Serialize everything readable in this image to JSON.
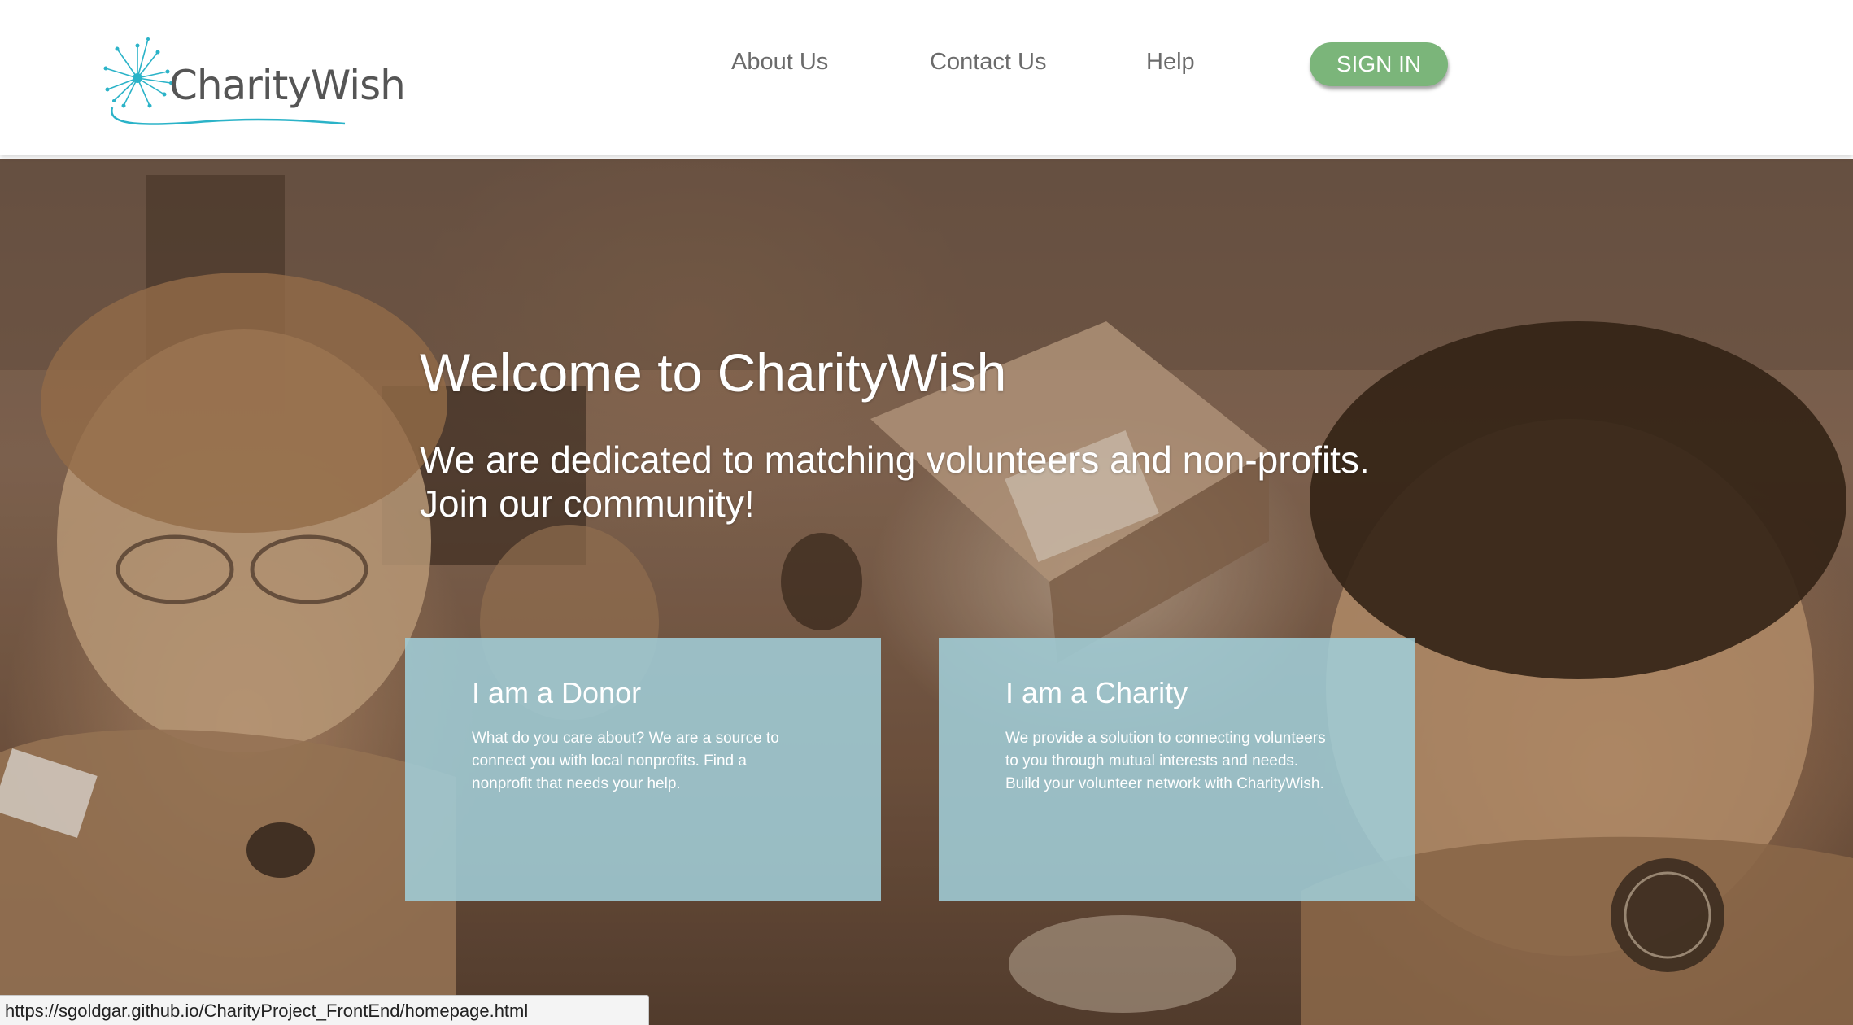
{
  "brand": {
    "name": "CharityWish",
    "logo_icon": "dandelion-logo-icon",
    "accent_color": "#2bb3c8"
  },
  "nav": {
    "about": "About Us",
    "contact": "Contact Us",
    "help": "Help",
    "signin": "SIGN IN",
    "signin_color": "#7bb57a"
  },
  "hero": {
    "title": "Welcome to CharityWish",
    "subtitle_line1": "We are dedicated to matching volunteers and non-profits.",
    "subtitle_line2": "Join our community!"
  },
  "cards": {
    "donor": {
      "title": "I am a Donor",
      "lines": [
        "What do you care about? We are a source to",
        "connect you with local nonprofits. Find a",
        "nonprofit that needs your help."
      ]
    },
    "charity": {
      "title": "I am a Charity",
      "lines": [
        "We provide a solution to connecting volunteers",
        "to you through mutual interests and needs.",
        "Build your volunteer network with CharityWish."
      ]
    },
    "card_color": "#a0cdd7"
  },
  "status": {
    "url": "https://sgoldgar.github.io/CharityProject_FrontEnd/homepage.html"
  }
}
